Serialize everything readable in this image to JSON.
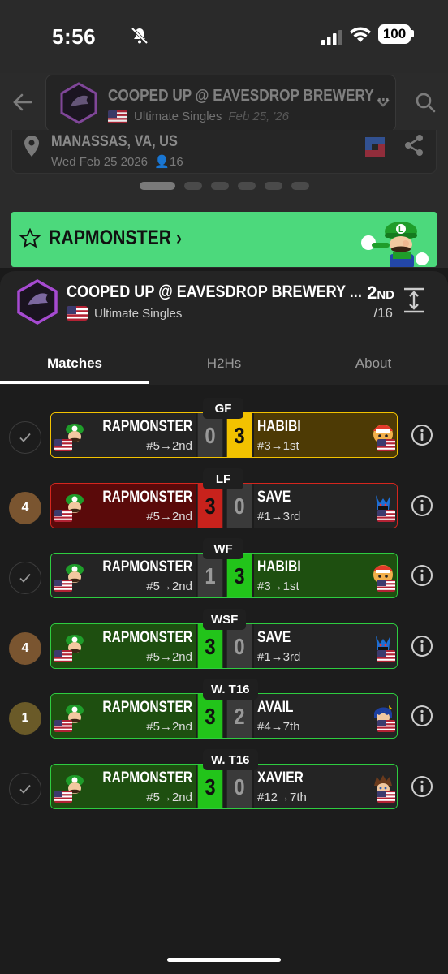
{
  "status_bar": {
    "time": "5:56",
    "battery": "100"
  },
  "background": {
    "event_title": "COOPED UP @ EAVESDROP BREWERY ...",
    "event_game": "Ultimate Singles",
    "event_date": "Feb 25, '26",
    "location": "MANASSAS, VA, US",
    "location_date": "Wed Feb 25 2026",
    "attendees": "16"
  },
  "banner": {
    "player_name": "RAPMONSTER",
    "arrow": "›"
  },
  "sheet": {
    "title": "COOPED UP @ EAVESDROP BREWERY ...",
    "game": "Ultimate Singles",
    "placement": "2",
    "placement_suffix": "ND",
    "total": "/16"
  },
  "tabs": {
    "matches": "Matches",
    "h2hs": "H2Hs",
    "about": "About"
  },
  "matches": [
    {
      "round": "GF",
      "badge": "check",
      "p1": "RAPMONSTER",
      "p1_seed": "#5→2nd",
      "s1": "0",
      "s2": "3",
      "p2": "HABIBI",
      "p2_seed": "#3→1st",
      "style": "loss-yellow"
    },
    {
      "round": "LF",
      "badge": "4",
      "p1": "RAPMONSTER",
      "p1_seed": "#5→2nd",
      "s1": "3",
      "s2": "0",
      "p2": "SAVE",
      "p2_seed": "#1→3rd",
      "style": "win-red"
    },
    {
      "round": "WF",
      "badge": "check",
      "p1": "RAPMONSTER",
      "p1_seed": "#5→2nd",
      "s1": "1",
      "s2": "3",
      "p2": "HABIBI",
      "p2_seed": "#3→1st",
      "style": "loss-green"
    },
    {
      "round": "WSF",
      "badge": "4",
      "p1": "RAPMONSTER",
      "p1_seed": "#5→2nd",
      "s1": "3",
      "s2": "0",
      "p2": "SAVE",
      "p2_seed": "#1→3rd",
      "style": "win-green"
    },
    {
      "round": "W. T16",
      "badge": "1",
      "p1": "RAPMONSTER",
      "p1_seed": "#5→2nd",
      "s1": "3",
      "s2": "2",
      "p2": "AVAIL",
      "p2_seed": "#4→7th",
      "style": "win-green"
    },
    {
      "round": "W. T16",
      "badge": "check",
      "p1": "RAPMONSTER",
      "p1_seed": "#5→2nd",
      "s1": "3",
      "s2": "0",
      "p2": "XAVIER",
      "p2_seed": "#12→7th",
      "style": "win-green"
    }
  ],
  "colors": {
    "banner_green": "#4cd97c",
    "win_green_border": "#2ecc40",
    "win_green_bg": "#1e4f10",
    "score_green": "#22c41a",
    "loss_red_bg": "#5a0a0a",
    "score_red": "#c8221c",
    "gold_bg": "#4d3a05",
    "score_gold": "#f2c200",
    "dark_box": "#242424"
  },
  "icons": {
    "back": "arrow-left-icon",
    "search": "search-icon",
    "expand": "chevron-down-icon",
    "location": "pin-icon",
    "share": "share-icon",
    "star": "star-icon",
    "collapse": "collapse-vertical-icon",
    "info": "info-icon",
    "check": "check-icon"
  }
}
